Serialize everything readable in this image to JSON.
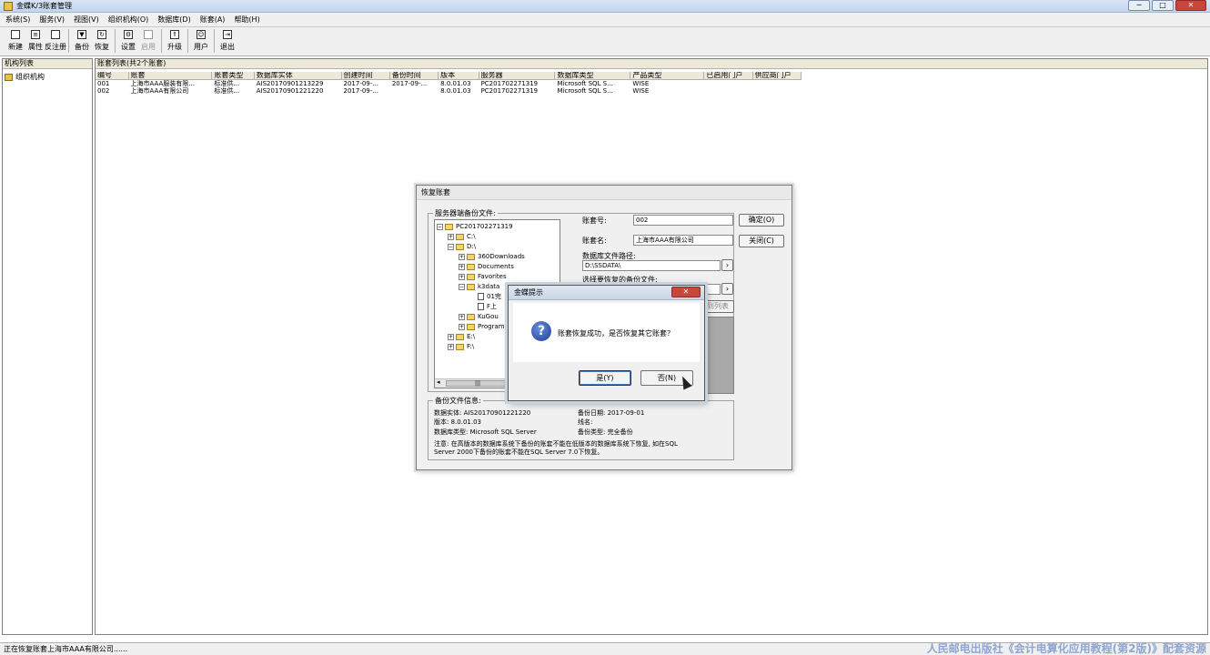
{
  "window": {
    "title": "金蝶K/3账套管理",
    "controls": [
      "─",
      "□",
      "✕"
    ]
  },
  "menu": [
    {
      "label": "系统(S)"
    },
    {
      "label": "服务(V)"
    },
    {
      "label": "视图(V)"
    },
    {
      "label": "组织机构(O)"
    },
    {
      "label": "数据库(D)"
    },
    {
      "label": "账套(A)"
    },
    {
      "label": "帮助(H)"
    }
  ],
  "toolbar": {
    "groups": [
      [
        {
          "label": "新建",
          "icon": "new-doc-icon",
          "glyph": ""
        },
        {
          "label": "属性",
          "icon": "properties-icon",
          "glyph": "≡"
        },
        {
          "label": "反注册",
          "icon": "unregister-icon",
          "glyph": ""
        }
      ],
      [
        {
          "label": "备份",
          "icon": "backup-icon",
          "glyph": "▼"
        },
        {
          "label": "恢复",
          "icon": "restore-icon",
          "glyph": "↻"
        }
      ],
      [
        {
          "label": "设置",
          "icon": "settings-icon",
          "glyph": "⚙"
        },
        {
          "label": "启用",
          "icon": "enable-icon",
          "glyph": "",
          "disabled": true
        }
      ],
      [
        {
          "label": "升级",
          "icon": "upgrade-icon",
          "glyph": "⇑"
        }
      ],
      [
        {
          "label": "用户",
          "icon": "user-icon",
          "glyph": "☺"
        }
      ],
      [
        {
          "label": "退出",
          "icon": "exit-icon",
          "glyph": "⇥"
        }
      ]
    ]
  },
  "left_panel": {
    "header": "机构列表",
    "root": "组织机构"
  },
  "right_panel": {
    "header": "账套列表(共2个账套)",
    "columns": [
      "编号",
      "账套",
      "账套类型",
      "数据库实体",
      "创建时间",
      "备份时间",
      "版本",
      "服务器",
      "数据库类型",
      "产品类型",
      "已启用门户",
      "供应商门户"
    ],
    "rows": [
      [
        "001",
        "上海市AAA服装有限...",
        "标准供...",
        "AIS20170901213229",
        "2017-09-...",
        "2017-09-...",
        "8.0.01.03",
        "PC201702271319",
        "Microsoft SQL S...",
        "WISE",
        "",
        ""
      ],
      [
        "002",
        "上海市AAA有限公司",
        "标准供...",
        "AIS20170901221220",
        "2017-09-...",
        "",
        "8.0.01.03",
        "PC201702271319",
        "Microsoft SQL S...",
        "WISE",
        "",
        ""
      ]
    ]
  },
  "restore_dialog": {
    "title": "恢复账套",
    "server_backup_legend": "服务器端备份文件:",
    "tree": [
      {
        "label": "PC201702271319",
        "depth": 0,
        "toggle": "−",
        "kind": "folder"
      },
      {
        "label": "C:\\",
        "depth": 1,
        "toggle": "+",
        "kind": "folder"
      },
      {
        "label": "D:\\",
        "depth": 1,
        "toggle": "−",
        "kind": "folder"
      },
      {
        "label": "360Downloads",
        "depth": 2,
        "toggle": "+",
        "kind": "folder"
      },
      {
        "label": "Documents",
        "depth": 2,
        "toggle": "+",
        "kind": "folder"
      },
      {
        "label": "Favorites",
        "depth": 2,
        "toggle": "+",
        "kind": "folder"
      },
      {
        "label": "k3data",
        "depth": 2,
        "toggle": "−",
        "kind": "folder"
      },
      {
        "label": "01完",
        "depth": 3,
        "toggle": "",
        "kind": "file"
      },
      {
        "label": "F上",
        "depth": 3,
        "toggle": "",
        "kind": "file"
      },
      {
        "label": "KuGou",
        "depth": 2,
        "toggle": "+",
        "kind": "folder"
      },
      {
        "label": "Program",
        "depth": 2,
        "toggle": "+",
        "kind": "folder"
      },
      {
        "label": "E:\\",
        "depth": 1,
        "toggle": "+",
        "kind": "folder"
      },
      {
        "label": "F:\\",
        "depth": 1,
        "toggle": "+",
        "kind": "folder"
      }
    ],
    "scroll_left": "◂",
    "scroll_thumb": "|||",
    "account_no_label": "账套号:",
    "account_no_value": "002",
    "account_name_label": "账套名:",
    "account_name_value": "上海市AAA有限公司",
    "db_path_label": "数据库文件路径:",
    "db_path_value": "D:\\SSDATA\\",
    "select_backup_label": "选择要恢复的备份文件:",
    "browse_glyph": "›",
    "ok_label": "确定(O)",
    "close_label": "关闭(C)",
    "add_list_label": "添加到列表",
    "backup_info_legend": "备份文件信息:",
    "info": {
      "entity_label": "数据实体:",
      "entity_value": "AIS20170901221220",
      "version_label": "版本:",
      "version_value": "8.0.01.03",
      "dbtype_label": "数据库类型:",
      "dbtype_value": "Microsoft SQL Server",
      "date_label": "备份日期:",
      "date_value": "2017-09-01",
      "line_label": "线名:",
      "line_value": "",
      "type_label": "备份类型:",
      "type_value": "完全备份",
      "note_line1": "注意: 在高版本的数据库系统下备份的账套不能在低版本的数据库系统下恢复, 如在SQL",
      "note_line2": "Server 2000下备份的账套不能在SQL Server 7.0下恢复。"
    }
  },
  "prompt": {
    "title": "金蝶提示",
    "close_glyph": "✕",
    "icon_glyph": "?",
    "message": "账套恢复成功，是否恢复其它账套？",
    "yes_label": "是(Y)",
    "no_label": "否(N)"
  },
  "status": {
    "text": "正在恢复账套上海市AAA有限公司......"
  },
  "watermark": "人民邮电出版社《会计电算化应用教程(第2版)》配套资源"
}
